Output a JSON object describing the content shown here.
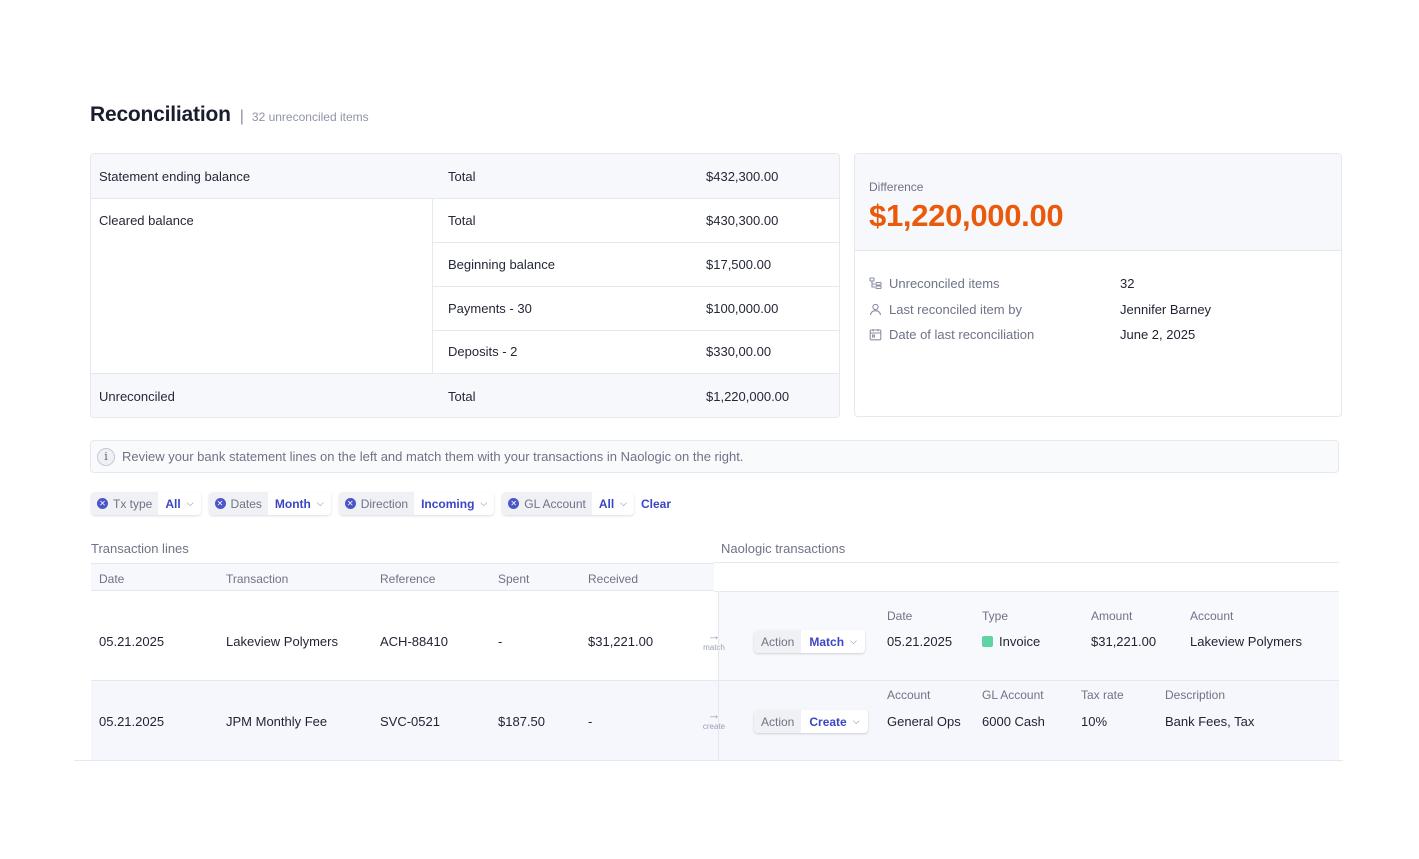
{
  "header": {
    "title": "Reconciliation",
    "separator": "|",
    "subtitle": "32 unreconciled items"
  },
  "balance": {
    "statement": {
      "label": "Statement ending balance",
      "name": "Total",
      "value": "$432,300.00"
    },
    "cleared": {
      "label": "Cleared balance",
      "rows": [
        {
          "name": "Total",
          "value": "$430,300.00"
        },
        {
          "name": "Beginning balance",
          "value": "$17,500.00"
        },
        {
          "name": "Payments - 30",
          "value": "$100,000.00"
        },
        {
          "name": "Deposits - 2",
          "value": "$330,00.00"
        }
      ]
    },
    "unreconciled": {
      "label": "Unreconciled",
      "name": "Total",
      "value": "$1,220,000.00"
    }
  },
  "difference": {
    "label": "Difference",
    "amount": "$1,220,000.00",
    "amount_color": "#ea5a0c",
    "details": [
      {
        "icon": "list-tree-icon",
        "key": "Unreconciled items",
        "value": "32"
      },
      {
        "icon": "user-icon",
        "key": "Last reconciled item by",
        "value": "Jennifer Barney"
      },
      {
        "icon": "calendar-icon",
        "key": "Date of last reconciliation",
        "value": "June 2, 2025"
      }
    ]
  },
  "info": {
    "icon_glyph": "i",
    "text": "Review your bank statement lines on the left and match them with your transactions in Naologic on the right."
  },
  "filters": {
    "items": [
      {
        "label": "Tx type",
        "value": "All"
      },
      {
        "label": "Dates",
        "value": "Month"
      },
      {
        "label": "Direction",
        "value": "Incoming"
      },
      {
        "label": "GL Account",
        "value": "All"
      }
    ],
    "clear_label": "Clear",
    "accent": "#3b46c4"
  },
  "transaction_lines": {
    "title": "Transaction lines",
    "columns": {
      "date": "Date",
      "transaction": "Transaction",
      "reference": "Reference",
      "spent": "Spent",
      "received": "Received"
    }
  },
  "naologic": {
    "title": "Naologic transactions"
  },
  "rows": [
    {
      "date": "05.21.2025",
      "transaction": "Lakeview Polymers",
      "reference": "ACH-88410",
      "spent": "-",
      "received": "$31,221.00",
      "arrow_glyph": "→",
      "arrow_label": "match",
      "action_label": "Action",
      "action_value": "Match",
      "details": [
        {
          "k": "Date",
          "v": "05.21.2025"
        },
        {
          "k": "Type",
          "v": "Invoice",
          "swatch": "#5fd3a3"
        },
        {
          "k": "Amount",
          "v": "$31,221.00"
        },
        {
          "k": "Account",
          "v": "Lakeview Polymers"
        }
      ]
    },
    {
      "date": "05.21.2025",
      "transaction": "JPM Monthly Fee",
      "reference": "SVC-0521",
      "spent": "$187.50",
      "received": "-",
      "arrow_glyph": "→",
      "arrow_label": "create",
      "action_label": "Action",
      "action_value": "Create",
      "details": [
        {
          "k": "Account",
          "v": "General Ops"
        },
        {
          "k": "GL Account",
          "v": "6000 Cash"
        },
        {
          "k": "Tax rate",
          "v": "10%"
        },
        {
          "k": "Description",
          "v": "Bank Fees, Tax"
        }
      ]
    }
  ]
}
